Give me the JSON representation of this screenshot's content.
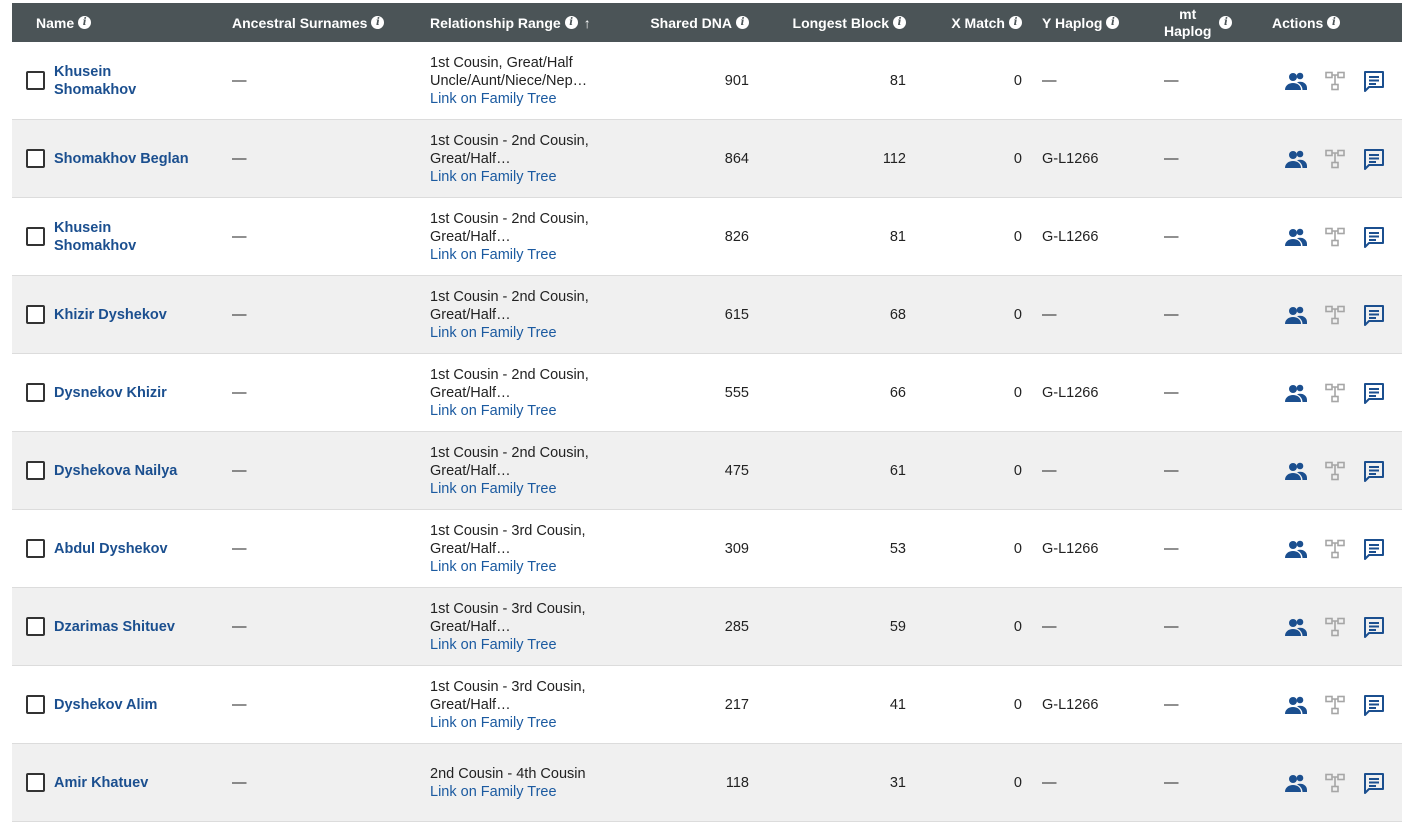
{
  "header": {
    "name": "Name",
    "ancestral_surnames": "Ancestral Surnames",
    "relationship_range": "Relationship Range",
    "shared_dna": "Shared DNA",
    "longest_block": "Longest Block",
    "x_match": "X Match",
    "y_haplog": "Y Haplog",
    "mt_haplog_line1": "mt",
    "mt_haplog_line2": "Haplog",
    "actions": "Actions",
    "info_glyph": "i",
    "sort_glyph": "↑"
  },
  "link_text": "Link on Family Tree",
  "colors": {
    "header_bg": "#4b5457",
    "link": "#1b4f8f",
    "row_alt": "#f0f0f0",
    "icon_active": "#1b4f8f",
    "icon_muted": "#a6a6a6"
  },
  "icons": {
    "people": "people-icon",
    "tree": "family-tree-icon",
    "message": "message-icon",
    "info": "info-icon",
    "sort": "sort-arrow-up-icon"
  },
  "rows": [
    {
      "name_line1": "Khusein",
      "name_line2": "Shomakhov",
      "surnames": "—",
      "rel_line1": "1st Cousin, Great/Half",
      "rel_line2": "Uncle/Aunt/Niece/Nep…",
      "shared_dna": "901",
      "longest_block": "81",
      "x_match": "0",
      "y_haplog": "—",
      "mt_haplog": "—"
    },
    {
      "name_line1": "Shomakhov Beglan",
      "name_line2": "",
      "surnames": "—",
      "rel_line1": "1st Cousin - 2nd Cousin,",
      "rel_line2": "Great/Half…",
      "shared_dna": "864",
      "longest_block": "112",
      "x_match": "0",
      "y_haplog": "G-L1266",
      "mt_haplog": "—"
    },
    {
      "name_line1": "Khusein",
      "name_line2": "Shomakhov",
      "surnames": "—",
      "rel_line1": "1st Cousin - 2nd Cousin,",
      "rel_line2": "Great/Half…",
      "shared_dna": "826",
      "longest_block": "81",
      "x_match": "0",
      "y_haplog": "G-L1266",
      "mt_haplog": "—"
    },
    {
      "name_line1": "Khizir Dyshekov",
      "name_line2": "",
      "surnames": "—",
      "rel_line1": "1st Cousin - 2nd Cousin,",
      "rel_line2": "Great/Half…",
      "shared_dna": "615",
      "longest_block": "68",
      "x_match": "0",
      "y_haplog": "—",
      "mt_haplog": "—"
    },
    {
      "name_line1": "Dysnekov Khizir",
      "name_line2": "",
      "surnames": "—",
      "rel_line1": "1st Cousin - 2nd Cousin,",
      "rel_line2": "Great/Half…",
      "shared_dna": "555",
      "longest_block": "66",
      "x_match": "0",
      "y_haplog": "G-L1266",
      "mt_haplog": "—"
    },
    {
      "name_line1": "Dyshekova Nailya",
      "name_line2": "",
      "surnames": "—",
      "rel_line1": "1st Cousin - 2nd Cousin,",
      "rel_line2": "Great/Half…",
      "shared_dna": "475",
      "longest_block": "61",
      "x_match": "0",
      "y_haplog": "—",
      "mt_haplog": "—"
    },
    {
      "name_line1": "Abdul Dyshekov",
      "name_line2": "",
      "surnames": "—",
      "rel_line1": "1st Cousin - 3rd Cousin,",
      "rel_line2": "Great/Half…",
      "shared_dna": "309",
      "longest_block": "53",
      "x_match": "0",
      "y_haplog": "G-L1266",
      "mt_haplog": "—"
    },
    {
      "name_line1": "Dzarimas Shituev",
      "name_line2": "",
      "surnames": "—",
      "rel_line1": "1st Cousin - 3rd Cousin,",
      "rel_line2": "Great/Half…",
      "shared_dna": "285",
      "longest_block": "59",
      "x_match": "0",
      "y_haplog": "—",
      "mt_haplog": "—"
    },
    {
      "name_line1": "Dyshekov Alim",
      "name_line2": "",
      "surnames": "—",
      "rel_line1": "1st Cousin - 3rd Cousin,",
      "rel_line2": "Great/Half…",
      "shared_dna": "217",
      "longest_block": "41",
      "x_match": "0",
      "y_haplog": "G-L1266",
      "mt_haplog": "—"
    },
    {
      "name_line1": "Amir Khatuev",
      "name_line2": "",
      "surnames": "—",
      "rel_line1": "2nd Cousin - 4th Cousin",
      "rel_line2": "",
      "shared_dna": "118",
      "longest_block": "31",
      "x_match": "0",
      "y_haplog": "—",
      "mt_haplog": "—"
    }
  ]
}
